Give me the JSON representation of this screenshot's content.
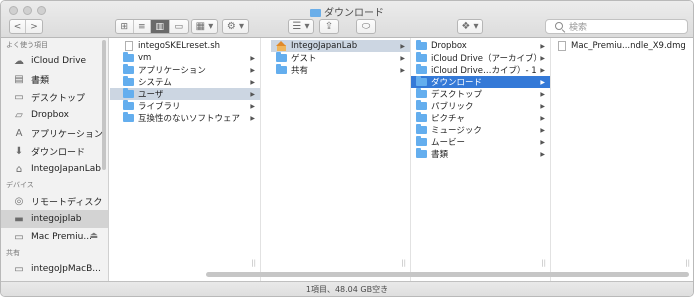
{
  "window": {
    "title": "ダウンロード"
  },
  "toolbar": {
    "back": "<",
    "forward": ">",
    "view_icons": "⊞",
    "view_list": "≡",
    "view_columns": "▥",
    "view_gallery": "▭",
    "group_label": "▦ ▾",
    "action_label": "⚙ ▾",
    "arrange_label": "☰ ▾",
    "share_label": "⇪",
    "tag_label": "⬭",
    "dropbox_label": "❖ ▾",
    "search_placeholder": "検索"
  },
  "sidebar": {
    "sections": [
      {
        "title": "よく使う項目",
        "items": [
          {
            "label": "iCloud Drive",
            "icon": "cloud-icon",
            "glyph": "☁"
          },
          {
            "label": "書類",
            "icon": "documents-icon",
            "glyph": "▤"
          },
          {
            "label": "デスクトップ",
            "icon": "desktop-icon",
            "glyph": "▭"
          },
          {
            "label": "Dropbox",
            "icon": "folder-icon",
            "glyph": "▱"
          },
          {
            "label": "アプリケーション",
            "icon": "applications-icon",
            "glyph": "A"
          },
          {
            "label": "ダウンロード",
            "icon": "downloads-icon",
            "glyph": "⬇"
          },
          {
            "label": "IntegoJapanLab",
            "icon": "home-icon",
            "glyph": "⌂"
          }
        ]
      },
      {
        "title": "デバイス",
        "items": [
          {
            "label": "リモートディスク",
            "icon": "disc-icon",
            "glyph": "◎"
          },
          {
            "label": "integojplab",
            "icon": "hard-drive-icon",
            "glyph": "▬"
          },
          {
            "label": "Mac Premiu...",
            "icon": "laptop-icon",
            "glyph": "▭",
            "trail": "⏏"
          }
        ]
      },
      {
        "title": "共有",
        "items": [
          {
            "label": "integoJpMacB...",
            "icon": "computer-icon",
            "glyph": "▭"
          }
        ]
      }
    ]
  },
  "columns": [
    {
      "name": "column-root",
      "rows": [
        {
          "label": "integoSKELreset.sh",
          "type": "doc"
        },
        {
          "label": "vm",
          "type": "folder",
          "arrow": true
        },
        {
          "label": "アプリケーション",
          "type": "folder",
          "arrow": true
        },
        {
          "label": "システム",
          "type": "folder",
          "arrow": true
        },
        {
          "label": "ユーザ",
          "type": "folder",
          "arrow": true,
          "state": "sel"
        },
        {
          "label": "ライブラリ",
          "type": "folder",
          "arrow": true
        },
        {
          "label": "互換性のないソフトウェア",
          "type": "folder",
          "arrow": true
        }
      ]
    },
    {
      "name": "column-users",
      "rows": [
        {
          "label": "IntegoJapanLab",
          "type": "home",
          "arrow": true,
          "state": "sel"
        },
        {
          "label": "ゲスト",
          "type": "folder",
          "arrow": true
        },
        {
          "label": "共有",
          "type": "folder",
          "arrow": true
        }
      ]
    },
    {
      "name": "column-home",
      "rows": [
        {
          "label": "Dropbox",
          "type": "folder",
          "arrow": true
        },
        {
          "label": "iCloud Drive（アーカイブ）",
          "type": "folder",
          "arrow": true
        },
        {
          "label": "iCloud Drive…カイブ）- 1",
          "type": "folder",
          "arrow": true
        },
        {
          "label": "ダウンロード",
          "type": "folder",
          "arrow": true,
          "state": "sel-active"
        },
        {
          "label": "デスクトップ",
          "type": "folder",
          "arrow": true
        },
        {
          "label": "パブリック",
          "type": "folder",
          "arrow": true
        },
        {
          "label": "ピクチャ",
          "type": "folder",
          "arrow": true
        },
        {
          "label": "ミュージック",
          "type": "folder",
          "arrow": true
        },
        {
          "label": "ムービー",
          "type": "folder",
          "arrow": true
        },
        {
          "label": "書類",
          "type": "folder",
          "arrow": true
        }
      ]
    },
    {
      "name": "column-downloads",
      "rows": [
        {
          "label": "Mac_Premiu...ndle_X9.dmg",
          "type": "doc"
        }
      ]
    }
  ],
  "status": {
    "text": "1項目、48.04 GB空き"
  }
}
